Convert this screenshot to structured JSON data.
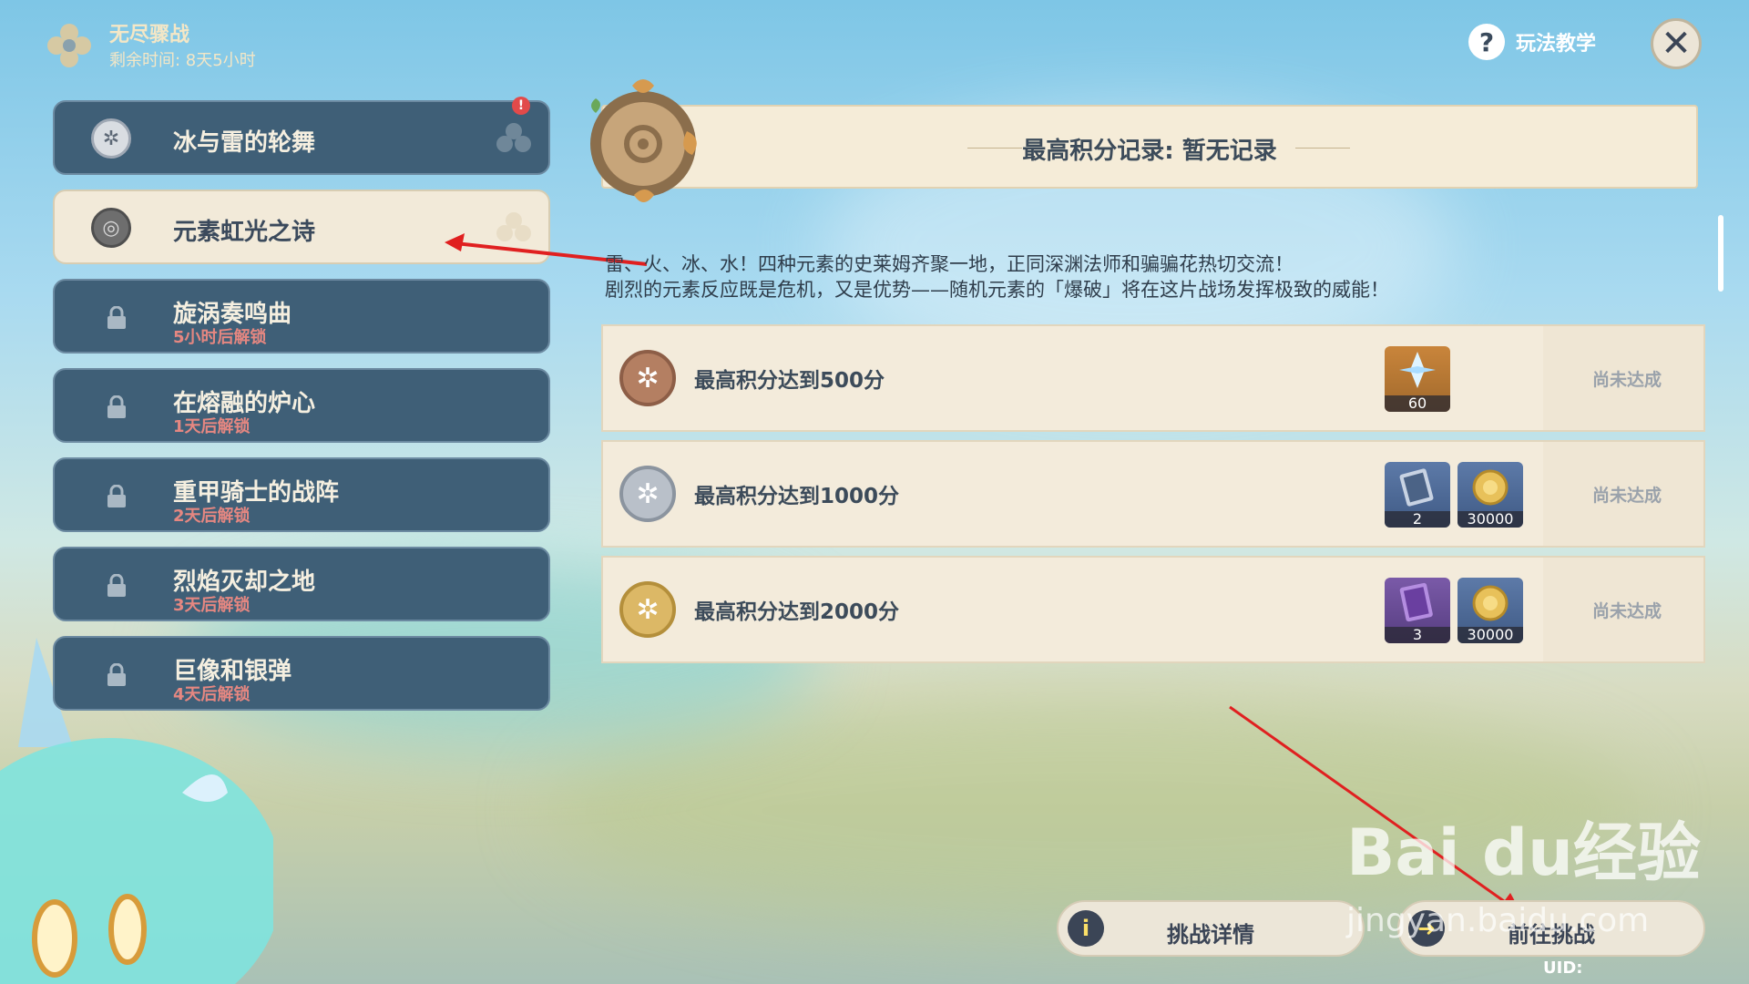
{
  "event": {
    "title": "无尽骤战",
    "remaining": "剩余时间: 8天5小时"
  },
  "help": {
    "label": "玩法教学",
    "icon": "question-icon"
  },
  "close": {
    "icon": "close-icon"
  },
  "levels": [
    {
      "name": "冰与雷的轮舞",
      "sub": "",
      "state": "unlocked",
      "alert": "!"
    },
    {
      "name": "元素虹光之诗",
      "sub": "",
      "state": "selected"
    },
    {
      "name": "旋涡奏鸣曲",
      "sub": "5小时后解锁",
      "state": "locked"
    },
    {
      "name": "在熔融的炉心",
      "sub": "1天后解锁",
      "state": "locked"
    },
    {
      "name": "重甲骑士的战阵",
      "sub": "2天后解锁",
      "state": "locked"
    },
    {
      "name": "烈焰灭却之地",
      "sub": "3天后解锁",
      "state": "locked"
    },
    {
      "name": "巨像和银弹",
      "sub": "4天后解锁",
      "state": "locked"
    }
  ],
  "score": {
    "text": "最高积分记录: 暂无记录"
  },
  "description": {
    "line1": "雷、火、冰、水！四种元素的史莱姆齐聚一地，正同深渊法师和骗骗花热切交流！",
    "line2": "剧烈的元素反应既是危机，又是优势——随机元素的「爆破」将在这片战场发挥极致的威能！"
  },
  "goals": [
    {
      "label": "最高积分达到500分",
      "medal": "bronze",
      "status": "尚未达成",
      "rewards": [
        {
          "item": "primogem",
          "qty": "60"
        }
      ]
    },
    {
      "label": "最高积分达到1000分",
      "medal": "silver",
      "status": "尚未达成",
      "rewards": [
        {
          "item": "heros-wit-book",
          "qty": "2"
        },
        {
          "item": "mora-coin",
          "qty": "30000"
        }
      ]
    },
    {
      "label": "最高积分达到2000分",
      "medal": "gold",
      "status": "尚未达成",
      "rewards": [
        {
          "item": "purple-book",
          "qty": "3"
        },
        {
          "item": "mora-coin",
          "qty": "30000"
        }
      ]
    }
  ],
  "buttons": {
    "details": "挑战详情",
    "go": "前往挑战"
  },
  "uid": "UID:",
  "watermark": {
    "main": "Bai du经验",
    "sub": "jingyan.baidu.com"
  },
  "colors": {
    "panel": "#f3ebdb",
    "levelBg": "#3f5f77",
    "accentRed": "#e24a4a",
    "unlockText": "#e58781"
  }
}
